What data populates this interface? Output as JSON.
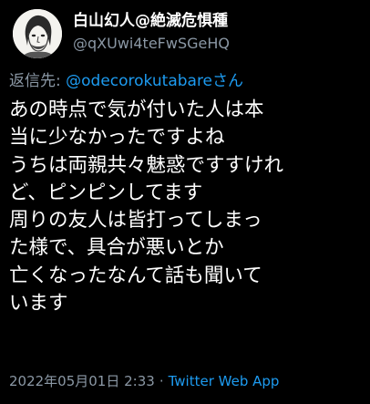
{
  "user": {
    "display_name": "白山幻人@絶滅危惧種",
    "handle": "@qXUwi4teFwSGeHQ",
    "avatar_icon": "user-avatar-sketch"
  },
  "reply": {
    "label": "返信先: ",
    "user": "@odecorokutabareさん"
  },
  "tweet": {
    "lines": [
      "あの時点で気が付いた人は本",
      "当に少なかったですよね",
      "うちは両親共々魅惑ですすけれ",
      "ど、ピンピンしてます",
      "周りの友人は皆打ってしまっ",
      "た様で、具合が悪いとか",
      "亡くなったなんて話も聞いて",
      "います"
    ]
  },
  "meta": {
    "timestamp": "2022年05月01日 2:33",
    "separator": "·",
    "app": "Twitter Web App"
  },
  "colors": {
    "background": "#000000",
    "text": "#ffffff",
    "muted": "#8b98a5",
    "accent": "#1d9bf0"
  }
}
